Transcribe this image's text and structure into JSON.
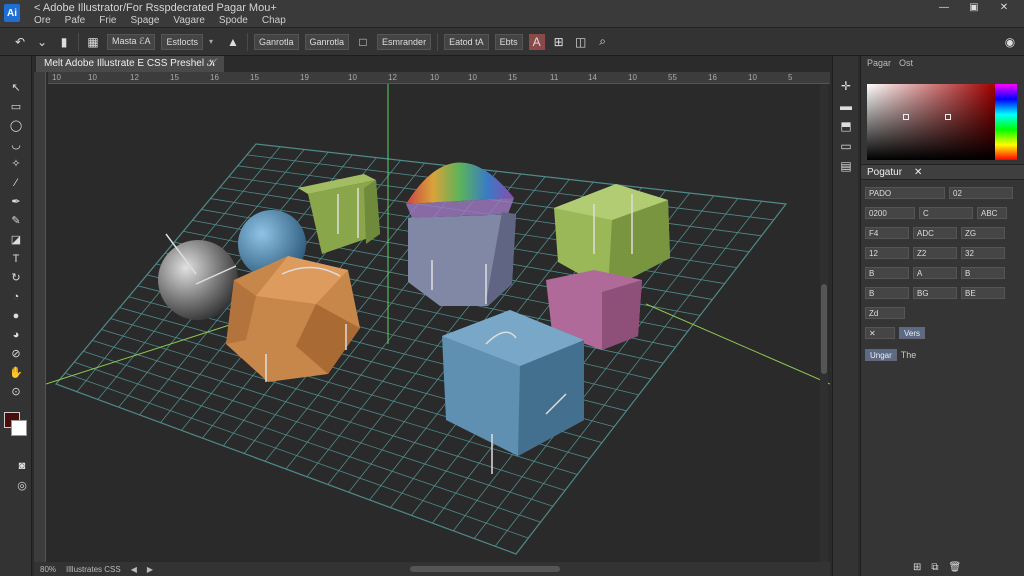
{
  "titlebar": {
    "title": "< Adobe Illustrator/For Rsspdecrated Pagar Mou+",
    "menu": [
      "Ore",
      "Pafe",
      "Frie",
      "Spage",
      "Vagare",
      "Spode",
      "Chap"
    ],
    "controls": [
      "—",
      "▣",
      "✕"
    ]
  },
  "controlbar": {
    "field1": "Masta ℰA",
    "field2": "Estlocts",
    "field3": "Ganrotla",
    "field4": "Ganrotla",
    "field5": "Esmrander",
    "field6": "Eatod tA",
    "field7": "Ebts"
  },
  "document": {
    "tab_label": "Melt Adobe Illustrate E CSS Preshel 𝒦",
    "ruler_marks": [
      "10",
      "10",
      "12",
      "15",
      "16",
      "15",
      "19",
      "10",
      "12",
      "10",
      "10",
      "15",
      "11",
      "14",
      "10",
      "55",
      "16",
      "10",
      "5"
    ]
  },
  "status": {
    "zoom": "80%",
    "file": "Illlustrates CSS"
  },
  "rpanel": {
    "tabs": [
      "Pagar",
      "Ost"
    ],
    "properties_title": "Pogatur",
    "close": "✕",
    "rows": [
      [
        "PADO",
        "02"
      ],
      [
        "0200",
        "C",
        "ABC"
      ],
      [
        "F4",
        "ADC",
        "ZG"
      ],
      [
        "12",
        "Z2",
        "32"
      ],
      [
        "B",
        "A",
        "B"
      ],
      [
        "B",
        "BG",
        "BE"
      ],
      [
        "Zd"
      ],
      [
        "Vers"
      ]
    ],
    "button_label": "Ungar",
    "button_suffix": "The"
  },
  "colors": {
    "fg_swatch": "#4b0c0c",
    "bg_swatch": "#ffffff",
    "canvas_bg": "#2a2a2a",
    "grid": "#5fb3b3"
  }
}
